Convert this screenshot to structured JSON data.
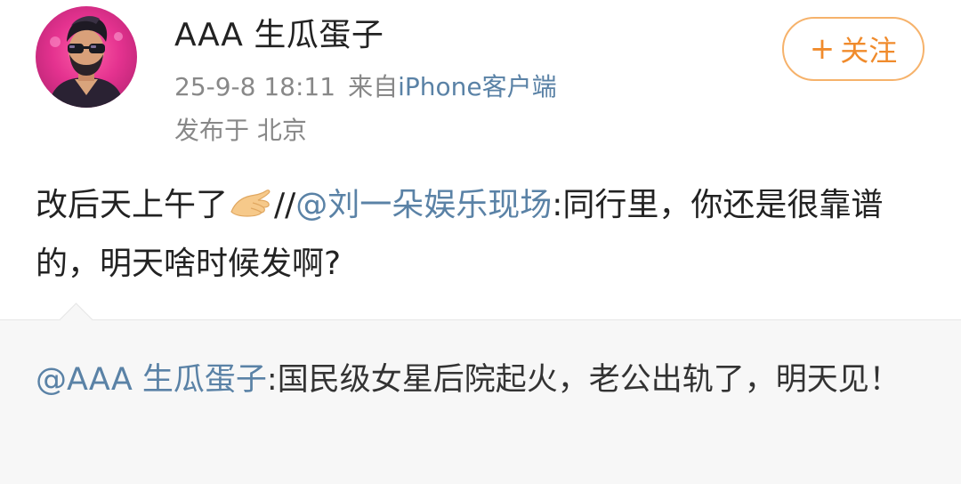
{
  "post": {
    "username": "AAA 生瓜蛋子",
    "timestamp": "25-9-8 18:11",
    "source_prefix": "来自",
    "source": "iPhone客户端",
    "location": "发布于 北京",
    "follow_icon": "+",
    "follow_label": "关注",
    "content": {
      "text_before_emoji": "改后天上午了",
      "emoji": "pinching-hand-emoji",
      "separator": "//",
      "mention": "@刘一朵娱乐现场",
      "text_after_mention": ":同行里，你还是很靠谱的，明天啥时候发啊?"
    }
  },
  "repost": {
    "mention": "@AAA 生瓜蛋子",
    "text": ":国民级女星后院起火，老公出轨了，明天见！"
  },
  "colors": {
    "accent_link": "#5a82a6",
    "follow_orange": "#f08b2c",
    "follow_border": "#f6b26b",
    "meta_gray": "#888888",
    "repost_bg": "#f7f7f7"
  }
}
